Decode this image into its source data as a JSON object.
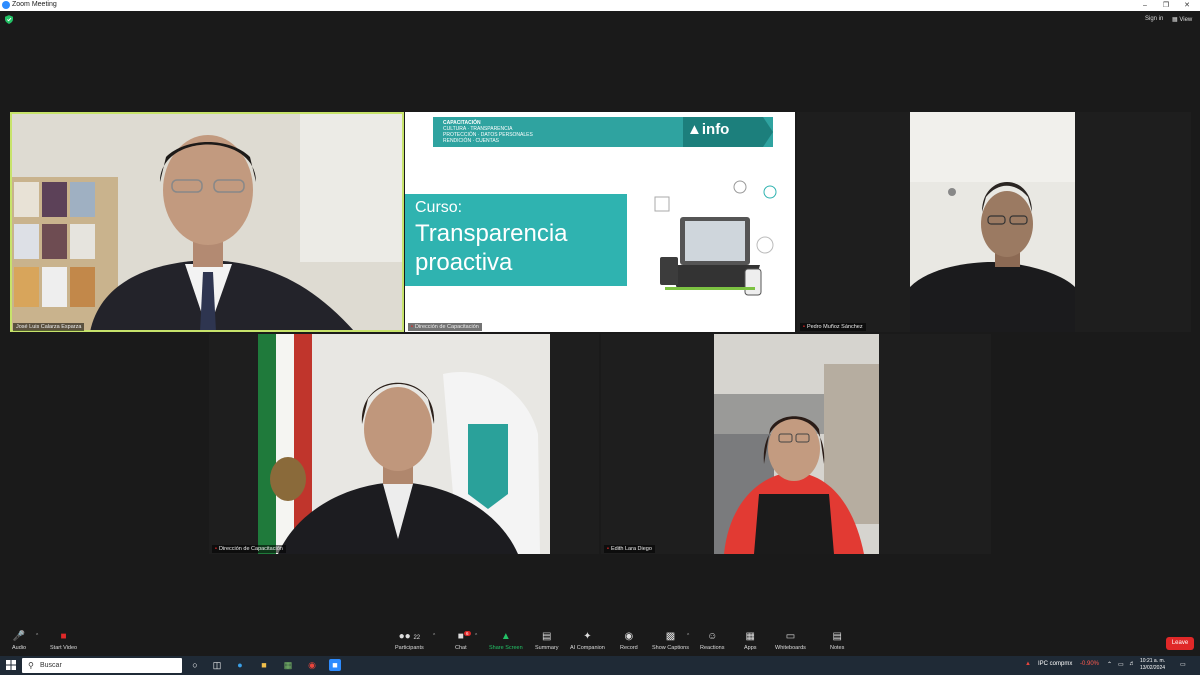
{
  "window": {
    "title": "Zoom Meeting"
  },
  "topbar": {
    "sign_in": "Sign in",
    "view": "View"
  },
  "participants": {
    "p1": {
      "name": "José Luis Calarza Esparza"
    },
    "p2": {
      "name": "Dirección de Capacitación"
    },
    "p3": {
      "name": "Pedro Muñoz Sánchez"
    },
    "p4": {
      "name": "Dirección de Capacitación"
    },
    "p5": {
      "name": "Edith Lara Diego"
    }
  },
  "slide": {
    "banner_lines": [
      "CAPACITACIÓN",
      "CULTURA · TRANSPARENCIA",
      "PROTECCIÓN · DATOS PERSONALES",
      "RENDICIÓN · CUENTAS"
    ],
    "logo": "info",
    "course_label": "Curso:",
    "course_title_1": "Transparencia",
    "course_title_2": "proactiva"
  },
  "toolbar": {
    "audio": "Audio",
    "start_video": "Start Video",
    "participants": "Participants",
    "participants_count": "22",
    "chat": "Chat",
    "chat_badge": "6",
    "share_screen": "Share Screen",
    "summary": "Summary",
    "ai_companion": "AI Companion",
    "record": "Record",
    "show_captions": "Show Captions",
    "reactions": "Reactions",
    "apps": "Apps",
    "whiteboards": "Whiteboards",
    "notes": "Notes",
    "leave": "Leave"
  },
  "taskbar": {
    "search_placeholder": "Buscar",
    "stock_name": "IPC compmx",
    "stock_change": "-0.90%",
    "time": "10:21 a. m.",
    "date": "13/02/2024"
  },
  "colors": {
    "active_speaker": "#c7e36b",
    "slide_teal": "#2fb3b0",
    "leave_red": "#e02828",
    "share_green": "#23c266"
  }
}
